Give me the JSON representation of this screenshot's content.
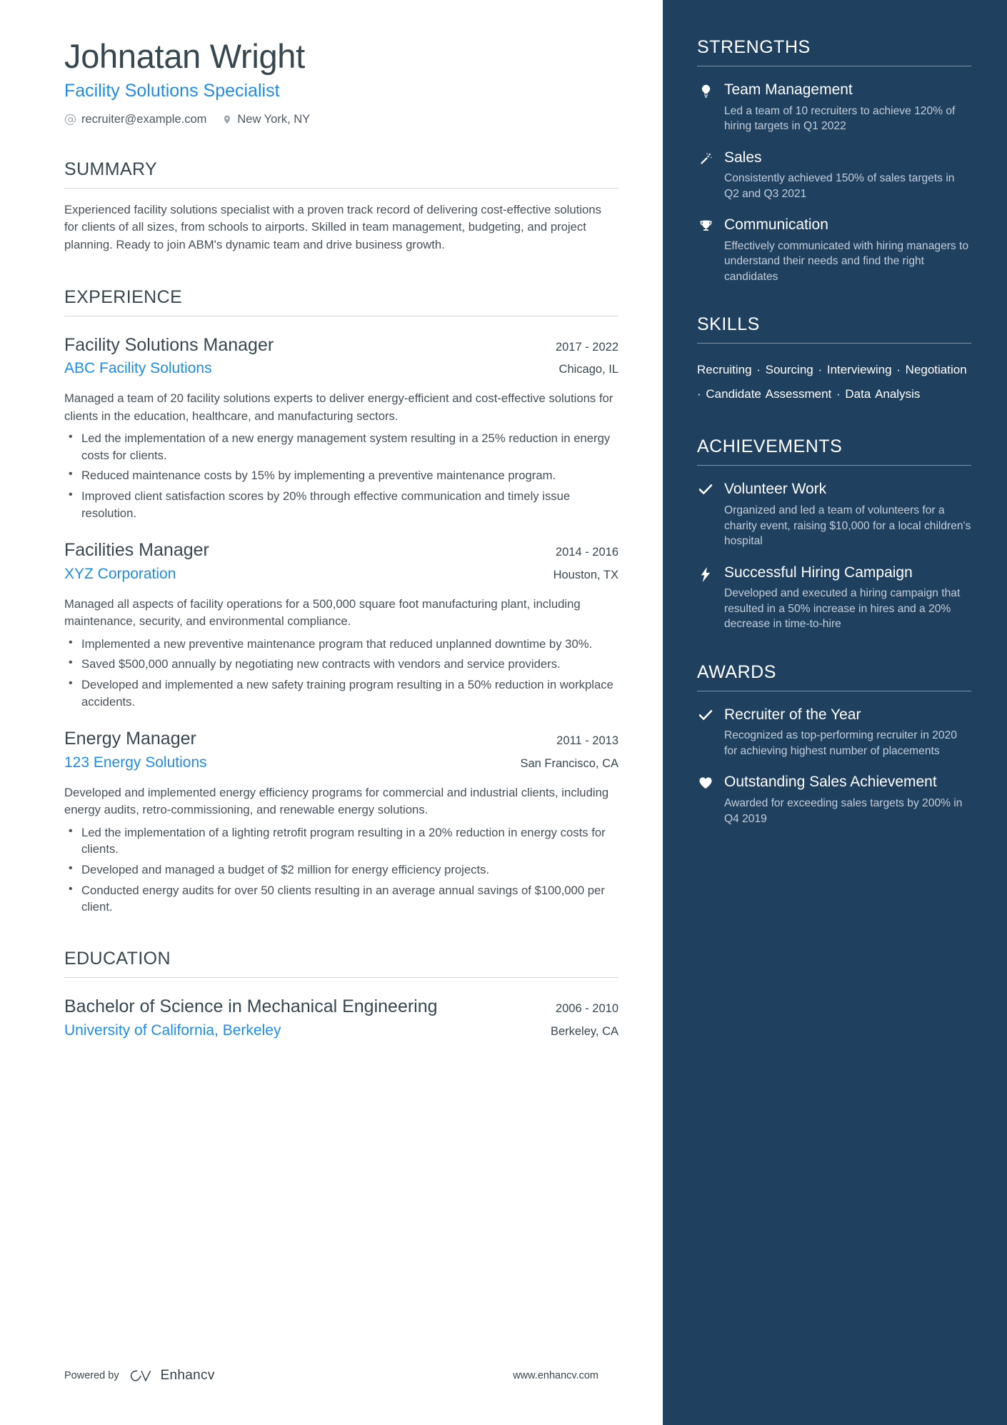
{
  "header": {
    "name": "Johnatan Wright",
    "title": "Facility Solutions Specialist",
    "email": "recruiter@example.com",
    "email_icon": "at-icon",
    "location": "New York, NY",
    "location_icon": "map-pin-icon"
  },
  "summary": {
    "heading": "SUMMARY",
    "text": "Experienced facility solutions specialist with a proven track record of delivering cost-effective solutions for clients of all sizes, from schools to airports. Skilled in team management, budgeting, and project planning. Ready to join ABM's dynamic team and drive business growth."
  },
  "experience": {
    "heading": "EXPERIENCE",
    "entries": [
      {
        "title": "Facility Solutions Manager",
        "company": "ABC Facility Solutions",
        "dates": "2017 - 2022",
        "location": "Chicago, IL",
        "description": "Managed a team of 20 facility solutions experts to deliver energy-efficient and cost-effective solutions for clients in the education, healthcare, and manufacturing sectors.",
        "bullets": [
          "Led the implementation of a new energy management system resulting in a 25% reduction in energy costs for clients.",
          "Reduced maintenance costs by 15% by implementing a preventive maintenance program.",
          "Improved client satisfaction scores by 20% through effective communication and timely issue resolution."
        ]
      },
      {
        "title": "Facilities Manager",
        "company": "XYZ Corporation",
        "dates": "2014 - 2016",
        "location": "Houston, TX",
        "description": "Managed all aspects of facility operations for a 500,000 square foot manufacturing plant, including maintenance, security, and environmental compliance.",
        "bullets": [
          "Implemented a new preventive maintenance program that reduced unplanned downtime by 30%.",
          "Saved $500,000 annually by negotiating new contracts with vendors and service providers.",
          "Developed and implemented a new safety training program resulting in a 50% reduction in workplace accidents."
        ]
      },
      {
        "title": "Energy Manager",
        "company": "123 Energy Solutions",
        "dates": "2011 - 2013",
        "location": "San Francisco, CA",
        "description": "Developed and implemented energy efficiency programs for commercial and industrial clients, including energy audits, retro-commissioning, and renewable energy solutions.",
        "bullets": [
          "Led the implementation of a lighting retrofit program resulting in a 20% reduction in energy costs for clients.",
          "Developed and managed a budget of $2 million for energy efficiency projects.",
          "Conducted energy audits for over 50 clients resulting in an average annual savings of $100,000 per client."
        ]
      }
    ]
  },
  "education": {
    "heading": "EDUCATION",
    "entries": [
      {
        "title": "Bachelor of Science in Mechanical Engineering",
        "school": "University of California, Berkeley",
        "dates": "2006 - 2010",
        "location": "Berkeley, CA"
      }
    ]
  },
  "footer": {
    "powered_by": "Powered by",
    "brand": "Enhancv",
    "brand_icon": "enhancv-logo-icon",
    "website": "www.enhancv.com"
  },
  "sidebar": {
    "strengths": {
      "heading": "STRENGTHS",
      "items": [
        {
          "icon": "lightbulb-icon",
          "title": "Team Management",
          "desc": "Led a team of 10 recruiters to achieve 120% of hiring targets in Q1 2022"
        },
        {
          "icon": "magic-wand-icon",
          "title": "Sales",
          "desc": "Consistently achieved 150% of sales targets in Q2 and Q3 2021"
        },
        {
          "icon": "trophy-icon",
          "title": "Communication",
          "desc": "Effectively communicated with hiring managers to understand their needs and find the right candidates"
        }
      ]
    },
    "skills": {
      "heading": "SKILLS",
      "list": "Recruiting · Sourcing · Interviewing · Negotiation · Candidate Assessment · Data Analysis"
    },
    "achievements": {
      "heading": "ACHIEVEMENTS",
      "items": [
        {
          "icon": "check-icon",
          "title": "Volunteer Work",
          "desc": "Organized and led a team of volunteers for a charity event, raising $10,000 for a local children's hospital"
        },
        {
          "icon": "lightning-bolt-icon",
          "title": "Successful Hiring Campaign",
          "desc": "Developed and executed a hiring campaign that resulted in a 50% increase in hires and a 20% decrease in time-to-hire"
        }
      ]
    },
    "awards": {
      "heading": "AWARDS",
      "items": [
        {
          "icon": "check-icon",
          "title": "Recruiter of the Year",
          "desc": "Recognized as top-performing recruiter in 2020 for achieving highest number of placements"
        },
        {
          "icon": "heart-icon",
          "title": "Outstanding Sales Achievement",
          "desc": "Awarded for exceeding sales targets by 200% in Q4 2019"
        }
      ]
    }
  },
  "colors": {
    "accent_blue": "#1f8ceb",
    "sidebar_bg": "#20405f",
    "text_dark": "#37474f"
  }
}
